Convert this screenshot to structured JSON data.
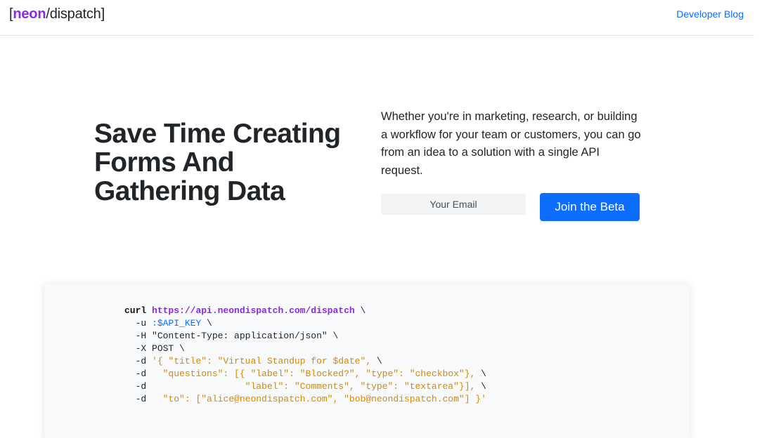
{
  "header": {
    "brand_open": "[",
    "brand_accent": "neon",
    "brand_rest": "/dispatch]",
    "nav_link": "Developer Blog"
  },
  "hero": {
    "title_lines": [
      "Save Time Creating",
      "Forms And",
      "Gathering Data"
    ],
    "description": "Whether you're in marketing, research, or building a workflow for your team or customers, you can go from an idea to a solution with a single API request.",
    "email_placeholder": "Your Email",
    "cta_label": "Join the Beta"
  },
  "code": {
    "lines": [
      {
        "flag": "curl",
        "value": "https://api.neondispatch.com/dispatch",
        "tail": " \\"
      },
      {
        "flag": "  -u",
        "value": ":$API_KEY",
        "tail": " \\"
      },
      {
        "flag": "  -H",
        "value": "\"Content-Type: application/json\"",
        "tail": " \\"
      },
      {
        "flag": "  -X",
        "value": "POST",
        "tail": " \\"
      },
      {
        "flag": "  -d",
        "value": "'{ \"title\": \"Virtual Standup for $date\",",
        "tail": " \\"
      },
      {
        "flag": "  -d",
        "value": "  \"questions\": [{ \"label\": \"Blocked?\", \"type\": \"checkbox\"},",
        "tail": " \\"
      },
      {
        "flag": "  -d",
        "value": "                 \"label\": \"Comments\", \"type\": \"textarea\"}],",
        "tail": " \\"
      },
      {
        "flag": "  -d",
        "value": "  \"to\": [\"alice@neondispatch.com\", \"bob@neondispatch.com\"] }'",
        "tail": ""
      }
    ]
  },
  "colors": {
    "accent": "#8a2be2",
    "primary": "#0d6efd",
    "string": "#d48a00"
  }
}
